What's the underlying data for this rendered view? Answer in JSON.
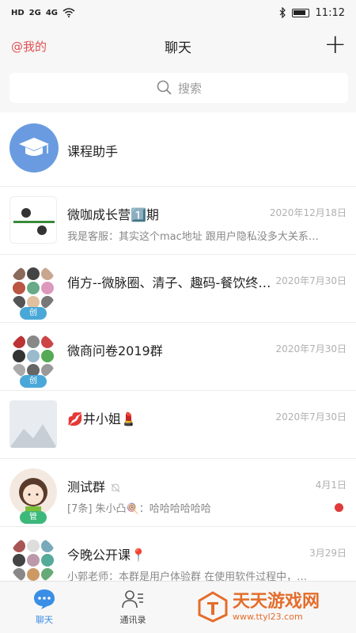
{
  "status": {
    "left_icons": [
      "HD-icon",
      "signal-4g-icon",
      "signal-icon",
      "wifi-icon"
    ],
    "sig1": "2G",
    "sig2": "4G",
    "time": "11:12"
  },
  "header": {
    "mine": "@我的",
    "title": "聊天",
    "add": "+"
  },
  "search": {
    "placeholder": "搜索"
  },
  "chats": [
    {
      "name": "课程助手",
      "date": "",
      "preview": "",
      "avatar": "graduation-cap-icon"
    },
    {
      "name": "微咖成长营1️⃣期",
      "date": "2020年12月18日",
      "preview": "我是客服：其实这个mac地址 跟用户隐私没多大关系…"
    },
    {
      "name": "俏方--微脉圈、清子、趣码-餐饮终…",
      "date": "2020年7月30日",
      "preview": "",
      "badge": "创"
    },
    {
      "name": "微商问卷2019群",
      "date": "2020年7月30日",
      "preview": "",
      "badge": "创"
    },
    {
      "name": "💋井小姐💄",
      "date": "2020年7月30日",
      "preview": ""
    },
    {
      "name": "测试群",
      "date": "4月1日",
      "preview": "[7条] 朱小凸🍭：哈哈哈哈哈哈",
      "badge": "管",
      "unread": true
    },
    {
      "name": "今晚公开课📍",
      "date": "3月29日",
      "preview": "小郭老师：本群是用户体验群 在使用软件过程中，…"
    }
  ],
  "tabs": {
    "chat": "聊天",
    "contacts": "通讯录"
  },
  "watermark": {
    "name": "天天游戏网",
    "url": "www.ttyl23.com"
  }
}
